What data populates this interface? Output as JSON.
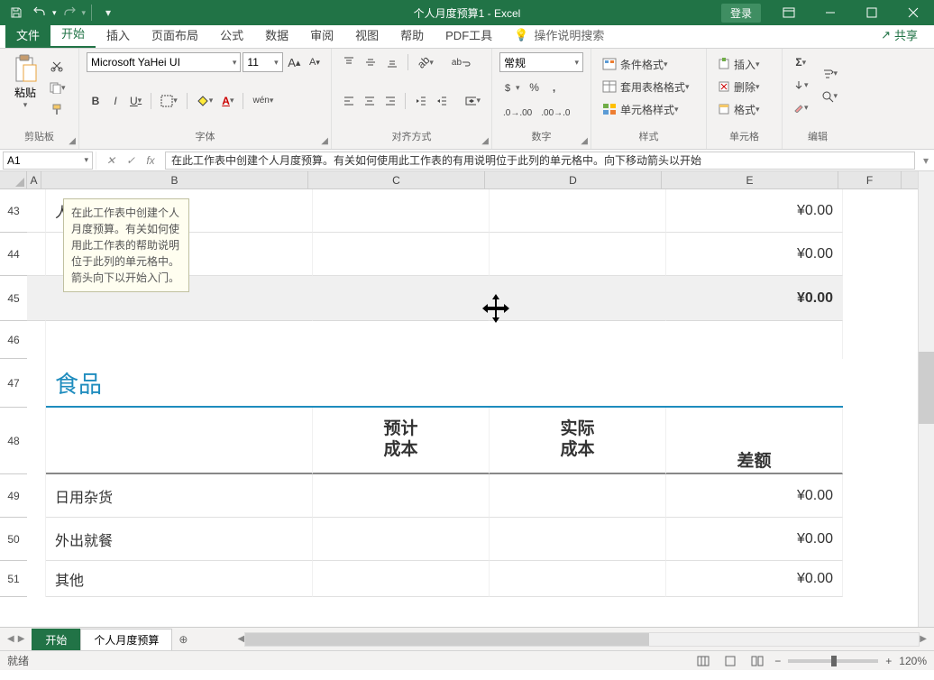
{
  "titlebar": {
    "title": "个人月度预算1 - Excel",
    "login": "登录"
  },
  "tabs": {
    "file": "文件",
    "home": "开始",
    "insert": "插入",
    "layout": "页面布局",
    "formula": "公式",
    "data": "数据",
    "review": "审阅",
    "view": "视图",
    "help": "帮助",
    "pdf": "PDF工具",
    "tell": "操作说明搜索",
    "share": "共享"
  },
  "ribbon": {
    "clipboard": {
      "paste": "粘贴",
      "group": "剪贴板"
    },
    "font": {
      "name": "Microsoft YaHei UI",
      "size": "11",
      "group": "字体",
      "bold": "B",
      "italic": "I",
      "underline": "U",
      "pinyin": "wén"
    },
    "align": {
      "group": "对齐方式",
      "wrap": "ab"
    },
    "number": {
      "format": "常规",
      "group": "数字",
      "currency": "%",
      "comma": ","
    },
    "styles": {
      "cond": "条件格式",
      "table": "套用表格格式",
      "cell": "单元格样式",
      "group": "样式"
    },
    "cells": {
      "insert": "插入",
      "delete": "删除",
      "format": "格式",
      "group": "单元格"
    },
    "editing": {
      "group": "编辑",
      "sigma": "Σ"
    }
  },
  "fbar": {
    "cell": "A1",
    "formula": "在此工作表中创建个人月度预算。有关如何使用此工作表的有用说明位于此列的单元格中。向下移动箭头以开始"
  },
  "cols": {
    "A": "A",
    "B": "B",
    "C": "C",
    "D": "D",
    "E": "E",
    "F": "F"
  },
  "rows": {
    "r43": "43",
    "r44": "44",
    "r45": "45",
    "r46": "46",
    "r47": "47",
    "r48": "48",
    "r49": "49",
    "r50": "50",
    "r51": "51"
  },
  "tooltip": "在此工作表中创建个人月度预算。有关如何使用此工作表的帮助说明位于此列的单元格中。箭头向下以开始入门。",
  "sheet": {
    "r43_b": "人寿",
    "r43_e": "¥0.00",
    "r44_e": "¥0.00",
    "r45_e": "¥0.00",
    "r47_b": "食品",
    "r48_c1": "预计",
    "r48_c2": "成本",
    "r48_d1": "实际",
    "r48_d2": "成本",
    "r48_e": "差额",
    "r49_b": "日用杂货",
    "r49_e": "¥0.00",
    "r50_b": "外出就餐",
    "r50_e": "¥0.00",
    "r51_b": "其他",
    "r51_e": "¥0.00"
  },
  "sheets": {
    "s1": "开始",
    "s2": "个人月度预算"
  },
  "status": {
    "ready": "就绪",
    "zoom": "120%"
  }
}
